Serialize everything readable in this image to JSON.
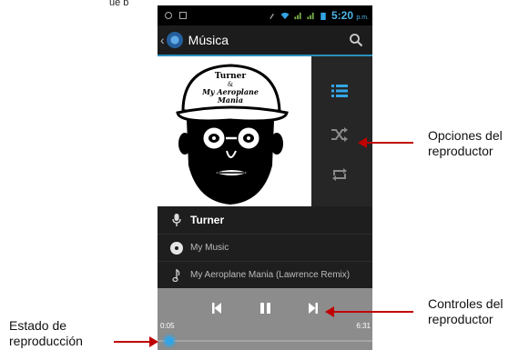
{
  "top_fragment": "ue p",
  "status_bar": {
    "time": "5:20",
    "time_suffix": "p.m."
  },
  "action_bar": {
    "title": "Música"
  },
  "album_art": {
    "cap_lines": [
      "Turner",
      "&",
      "My Aeroplane",
      "Mania"
    ]
  },
  "now_playing": {
    "artist": "Turner",
    "album": "My Music",
    "track": "My Aeroplane Mania (Lawrence Remix)"
  },
  "playback": {
    "elapsed": "0:05",
    "duration": "6:31",
    "progress": 0.013
  },
  "callouts": {
    "options_line1": "Opciones del",
    "options_line2": "reproductor",
    "controls_line1": "Controles del",
    "controls_line2": "reproductor",
    "status_line1": "Estado de",
    "status_line2": "reproducción"
  },
  "colors": {
    "accent": "#33a5e5",
    "arrow": "#c00000",
    "controls_bg": "#8c8c8c"
  }
}
